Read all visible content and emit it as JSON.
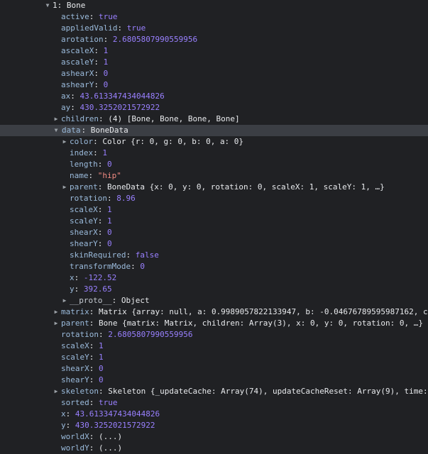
{
  "tree": {
    "rows": [
      {
        "indent": 0,
        "toggle": "open",
        "key": "1: Bone",
        "key_style": "strong",
        "value": ""
      },
      {
        "indent": 1,
        "toggle": "none",
        "key": "active",
        "value": "true",
        "vtype": "bool"
      },
      {
        "indent": 1,
        "toggle": "none",
        "key": "appliedValid",
        "value": "true",
        "vtype": "bool"
      },
      {
        "indent": 1,
        "toggle": "none",
        "key": "arotation",
        "value": "2.6805807990559956",
        "vtype": "num"
      },
      {
        "indent": 1,
        "toggle": "none",
        "key": "ascaleX",
        "value": "1",
        "vtype": "num"
      },
      {
        "indent": 1,
        "toggle": "none",
        "key": "ascaleY",
        "value": "1",
        "vtype": "num"
      },
      {
        "indent": 1,
        "toggle": "none",
        "key": "ashearX",
        "value": "0",
        "vtype": "num"
      },
      {
        "indent": 1,
        "toggle": "none",
        "key": "ashearY",
        "value": "0",
        "vtype": "num"
      },
      {
        "indent": 1,
        "toggle": "none",
        "key": "ax",
        "value": "43.613347434044826",
        "vtype": "num"
      },
      {
        "indent": 1,
        "toggle": "none",
        "key": "ay",
        "value": "430.3252021572922",
        "vtype": "num"
      },
      {
        "indent": 1,
        "toggle": "closed",
        "key": "children",
        "value": "(4) [Bone, Bone, Bone, Bone]",
        "vtype": "obj"
      },
      {
        "indent": 1,
        "toggle": "open",
        "key": "data",
        "value": "BoneData",
        "vtype": "obj",
        "selected": true
      },
      {
        "indent": 2,
        "toggle": "closed",
        "key": "color",
        "value": "Color {r: 0, g: 0, b: 0, a: 0}",
        "vtype": "obj"
      },
      {
        "indent": 2,
        "toggle": "none",
        "key": "index",
        "value": "1",
        "vtype": "num"
      },
      {
        "indent": 2,
        "toggle": "none",
        "key": "length",
        "value": "0",
        "vtype": "num"
      },
      {
        "indent": 2,
        "toggle": "none",
        "key": "name",
        "value": "\"hip\"",
        "vtype": "str"
      },
      {
        "indent": 2,
        "toggle": "closed",
        "key": "parent",
        "value": "BoneData {x: 0, y: 0, rotation: 0, scaleX: 1, scaleY: 1, …}",
        "vtype": "obj"
      },
      {
        "indent": 2,
        "toggle": "none",
        "key": "rotation",
        "value": "8.96",
        "vtype": "num"
      },
      {
        "indent": 2,
        "toggle": "none",
        "key": "scaleX",
        "value": "1",
        "vtype": "num"
      },
      {
        "indent": 2,
        "toggle": "none",
        "key": "scaleY",
        "value": "1",
        "vtype": "num"
      },
      {
        "indent": 2,
        "toggle": "none",
        "key": "shearX",
        "value": "0",
        "vtype": "num"
      },
      {
        "indent": 2,
        "toggle": "none",
        "key": "shearY",
        "value": "0",
        "vtype": "num"
      },
      {
        "indent": 2,
        "toggle": "none",
        "key": "skinRequired",
        "value": "false",
        "vtype": "bool"
      },
      {
        "indent": 2,
        "toggle": "none",
        "key": "transformMode",
        "value": "0",
        "vtype": "num"
      },
      {
        "indent": 2,
        "toggle": "none",
        "key": "x",
        "value": "-122.52",
        "vtype": "num"
      },
      {
        "indent": 2,
        "toggle": "none",
        "key": "y",
        "value": "392.65",
        "vtype": "num"
      },
      {
        "indent": 2,
        "toggle": "closed",
        "key": "__proto__",
        "key_style": "proto",
        "value": "Object",
        "vtype": "obj"
      },
      {
        "indent": 1,
        "toggle": "closed",
        "key": "matrix",
        "value": "Matrix {array: null, a: 0.9989057822133947, b: -0.04676789595987162, c…",
        "vtype": "obj"
      },
      {
        "indent": 1,
        "toggle": "closed",
        "key": "parent",
        "value": "Bone {matrix: Matrix, children: Array(3), x: 0, y: 0, rotation: 0, …}",
        "vtype": "obj"
      },
      {
        "indent": 1,
        "toggle": "none",
        "key": "rotation",
        "value": "2.6805807990559956",
        "vtype": "num"
      },
      {
        "indent": 1,
        "toggle": "none",
        "key": "scaleX",
        "value": "1",
        "vtype": "num"
      },
      {
        "indent": 1,
        "toggle": "none",
        "key": "scaleY",
        "value": "1",
        "vtype": "num"
      },
      {
        "indent": 1,
        "toggle": "none",
        "key": "shearX",
        "value": "0",
        "vtype": "num"
      },
      {
        "indent": 1,
        "toggle": "none",
        "key": "shearY",
        "value": "0",
        "vtype": "num"
      },
      {
        "indent": 1,
        "toggle": "closed",
        "key": "skeleton",
        "value": "Skeleton {_updateCache: Array(74), updateCacheReset: Array(9), time:…",
        "vtype": "obj"
      },
      {
        "indent": 1,
        "toggle": "none",
        "key": "sorted",
        "value": "true",
        "vtype": "bool"
      },
      {
        "indent": 1,
        "toggle": "none",
        "key": "x",
        "value": "43.613347434044826",
        "vtype": "num"
      },
      {
        "indent": 1,
        "toggle": "none",
        "key": "y",
        "value": "430.3252021572922",
        "vtype": "num"
      },
      {
        "indent": 1,
        "toggle": "none",
        "key": "worldX",
        "value": "(...)",
        "vtype": "get"
      },
      {
        "indent": 1,
        "toggle": "none",
        "key": "worldY",
        "value": "(...)",
        "vtype": "get"
      }
    ]
  },
  "colors": {
    "background": "#202124",
    "key": "#9bbbdc",
    "number": "#9980ff",
    "string": "#f28b82",
    "text": "#e8eaed",
    "selection": "#3b3e44"
  },
  "icons": {
    "expanded": "triangle-down-icon",
    "collapsed": "triangle-right-icon"
  }
}
